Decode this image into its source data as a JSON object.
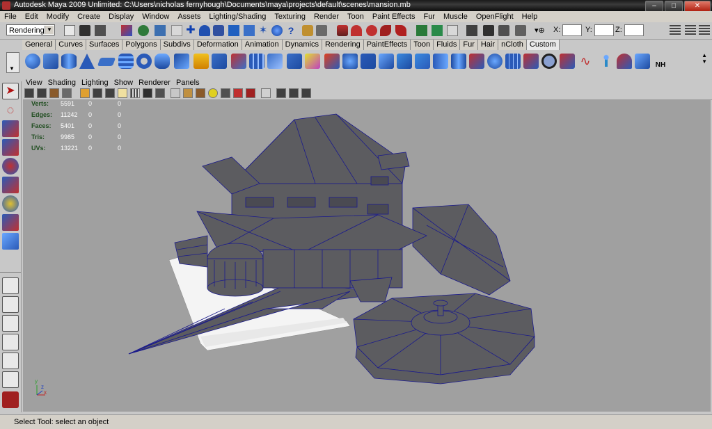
{
  "window": {
    "title": "Autodesk Maya 2009 Unlimited: C:\\Users\\nicholas fernyhough\\Documents\\maya\\projects\\default\\scenes\\mansion.mb",
    "min": "–",
    "max": "□",
    "close": "✕"
  },
  "menu": [
    "File",
    "Edit",
    "Modify",
    "Create",
    "Display",
    "Window",
    "Assets",
    "Lighting/Shading",
    "Texturing",
    "Render",
    "Toon",
    "Paint Effects",
    "Fur",
    "Muscle",
    "OpenFlight",
    "Help"
  ],
  "status_line": {
    "mode": "Rendering",
    "x_label": "X:",
    "y_label": "Y:",
    "z_label": "Z:"
  },
  "shelf_tabs": [
    "General",
    "Curves",
    "Surfaces",
    "Polygons",
    "Subdivs",
    "Deformation",
    "Animation",
    "Dynamics",
    "Rendering",
    "PaintEffects",
    "Toon",
    "Fluids",
    "Fur",
    "Hair",
    "nCloth",
    "Custom"
  ],
  "shelf_active": "Custom",
  "shelf_icon_last": "NH",
  "viewport_menu": [
    "View",
    "Shading",
    "Lighting",
    "Show",
    "Renderer",
    "Panels"
  ],
  "hud": {
    "rows": [
      {
        "label": "Verts:",
        "value": "5591",
        "a": "0",
        "b": "0"
      },
      {
        "label": "Edges:",
        "value": "11242",
        "a": "0",
        "b": "0"
      },
      {
        "label": "Faces:",
        "value": "5401",
        "a": "0",
        "b": "0"
      },
      {
        "label": "Tris:",
        "value": "9985",
        "a": "0",
        "b": "0"
      },
      {
        "label": "UVs:",
        "value": "13221",
        "a": "0",
        "b": "0"
      }
    ]
  },
  "axis": {
    "y": "y",
    "x": "x",
    "z": "z"
  },
  "status_bar": {
    "help": "Select Tool: select an object"
  },
  "colors": {
    "viewport_bg": "#a0a0a0",
    "wire": "#1a1a8c",
    "mesh": "#5c5c60",
    "ui_bg": "#c8c8c8"
  }
}
